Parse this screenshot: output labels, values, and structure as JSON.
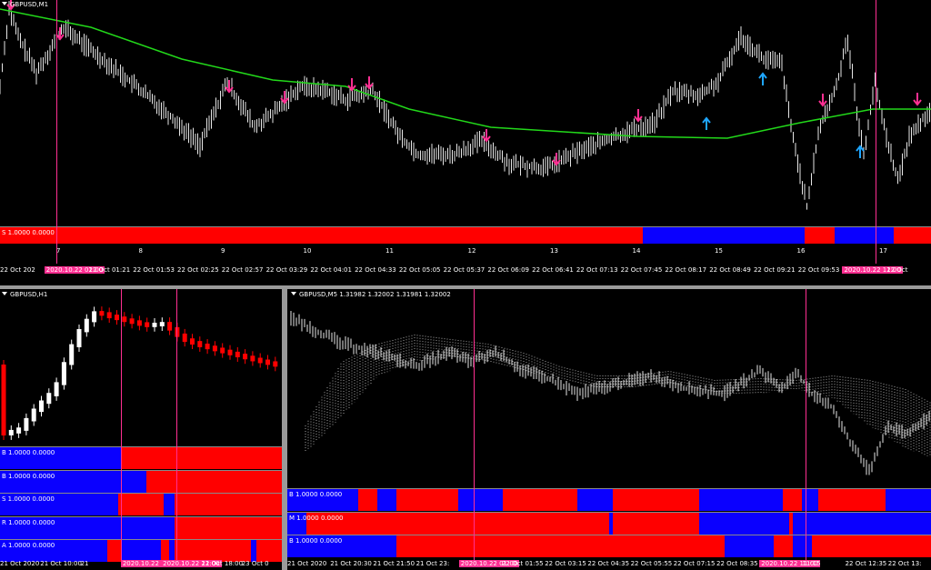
{
  "colors": {
    "bull": "#0a00ff",
    "bear": "#ff0000",
    "marker": "#ff2f92",
    "ma": "#22d81a",
    "sell_arrow": "#ff2f92",
    "buy_arrow": "#1ea6ff",
    "price": "#e6e6e6"
  },
  "top": {
    "title": "GBPUSD,M1",
    "strip": {
      "label": "S 1.0000 0.0000",
      "segments": [
        [
          "bear",
          0,
          0.69
        ],
        [
          "bull",
          0.69,
          0.864
        ],
        [
          "bear",
          0.864,
          0.896
        ],
        [
          "bull",
          0.896,
          0.96
        ],
        [
          "bear",
          0.96,
          1
        ]
      ]
    },
    "hours": [
      "7",
      "8",
      "9",
      "10",
      "11",
      "12",
      "13",
      "14",
      "15",
      "16",
      "17"
    ],
    "times": [
      "22 Oct 202",
      "2020.10.22 01:00",
      "22 Oct 01:21",
      "22 Oct 01:53",
      "22 Oct 02:25",
      "22 Oct 02:57",
      "22 Oct 03:29",
      "22 Oct 04:01",
      "22 Oct 04:33",
      "22 Oct 05:05",
      "22 Oct 05:37",
      "22 Oct 06:09",
      "22 Oct 06:41",
      "22 Oct 07:13",
      "22 Oct 07:45",
      "22 Oct 08:17",
      "22 Oct 08:49",
      "22 Oct 09:21",
      "22 Oct 09:53",
      "2020.10.22 11:00",
      "22 Oct"
    ],
    "markers": [
      0.061,
      0.94
    ]
  },
  "left": {
    "title": "GBPUSD,H1",
    "strips": [
      {
        "label": "B 1.0000 0.0000",
        "segments": [
          [
            "bull",
            0,
            0.43
          ],
          [
            "bear",
            0.43,
            1
          ]
        ]
      },
      {
        "label": "B 1.0000 0.0000",
        "segments": [
          [
            "bull",
            0,
            0.52
          ],
          [
            "bear",
            0.52,
            1
          ]
        ]
      },
      {
        "label": "S 1.0000 0.0000",
        "segments": [
          [
            "bull",
            0,
            0.42
          ],
          [
            "bear",
            0.42,
            0.58
          ],
          [
            "bull",
            0.58,
            0.62
          ],
          [
            "bear",
            0.62,
            1
          ]
        ]
      },
      {
        "label": "R 1.0000 0.0000",
        "segments": [
          [
            "bull",
            0,
            0.62
          ],
          [
            "bear",
            0.62,
            1
          ]
        ]
      },
      {
        "label": "A 1.0000 0.0000",
        "segments": [
          [
            "bull",
            0,
            0.38
          ],
          [
            "bear",
            0.38,
            0.43
          ],
          [
            "bull",
            0.43,
            0.57
          ],
          [
            "bear",
            0.57,
            0.6
          ],
          [
            "bull",
            0.6,
            0.62
          ],
          [
            "bear",
            0.62,
            0.89
          ],
          [
            "bull",
            0.89,
            0.91
          ],
          [
            "bear",
            0.91,
            1
          ]
        ]
      }
    ],
    "times": [
      "21 Oct 2020",
      "21 Oct 10:00",
      "21",
      "2020.10.22 01:00",
      "2020.10.22 11:00",
      "22 Oct 18:00",
      "23 Oct 0"
    ],
    "markers": [
      0.43,
      0.625
    ]
  },
  "right": {
    "title": "GBPUSD,M5  1.31982 1.32002 1.31981 1.32002",
    "strips": [
      {
        "label": "B 1.0000 0.0000",
        "segments": [
          [
            "bull",
            0,
            0.11
          ],
          [
            "bear",
            0.11,
            0.14
          ],
          [
            "bull",
            0.14,
            0.17
          ],
          [
            "bear",
            0.17,
            0.265
          ],
          [
            "bull",
            0.265,
            0.335
          ],
          [
            "bear",
            0.335,
            0.45
          ],
          [
            "bull",
            0.45,
            0.505
          ],
          [
            "bear",
            0.505,
            0.64
          ],
          [
            "bull",
            0.64,
            0.77
          ],
          [
            "bear",
            0.77,
            0.8
          ],
          [
            "bull",
            0.8,
            0.825
          ],
          [
            "bear",
            0.825,
            0.93
          ],
          [
            "bull",
            0.93,
            1
          ]
        ]
      },
      {
        "label": "M 1.0000 0.0000",
        "segments": [
          [
            "bull",
            0,
            0.03
          ],
          [
            "bear",
            0.03,
            0.5
          ],
          [
            "bull",
            0.5,
            0.505
          ],
          [
            "bear",
            0.505,
            0.64
          ],
          [
            "bull",
            0.64,
            0.78
          ],
          [
            "bear",
            0.78,
            0.785
          ],
          [
            "bull",
            0.785,
            1
          ]
        ]
      },
      {
        "label": "B 1.0000 0.0000",
        "segments": [
          [
            "bull",
            0,
            0.17
          ],
          [
            "bear",
            0.17,
            0.68
          ],
          [
            "bull",
            0.68,
            0.755
          ],
          [
            "bear",
            0.755,
            0.785
          ],
          [
            "bull",
            0.785,
            0.815
          ],
          [
            "bear",
            0.815,
            1
          ]
        ]
      }
    ],
    "times": [
      "21 Oct 2020",
      "21 Oct 20:30",
      "21 Oct 21:50",
      "21 Oct 23:",
      "2020.10.22 01:00",
      "22 Oct 01:55",
      "22 Oct 03:15",
      "22 Oct 04:35",
      "22 Oct 05:55",
      "22 Oct 07:15",
      "22 Oct 08:35",
      "2020.10.22 11:00",
      "11:15",
      "22 Oct 12:35",
      "22 Oct 13:"
    ],
    "markers": [
      0.29,
      0.805
    ]
  }
}
